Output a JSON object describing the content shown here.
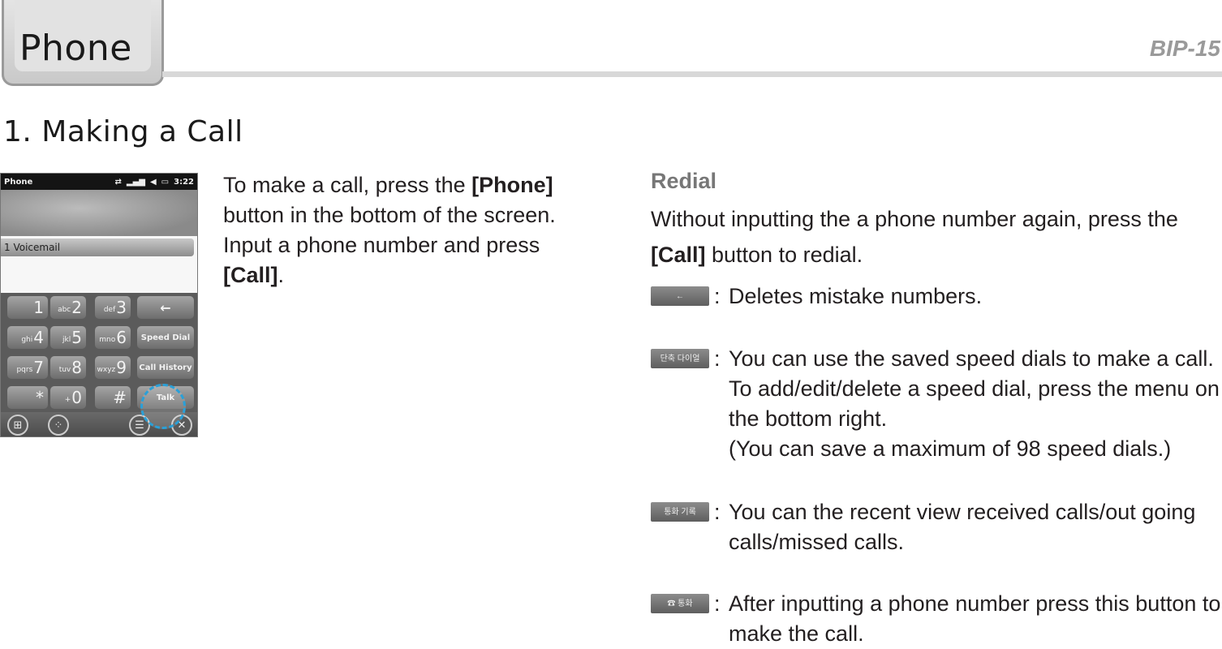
{
  "header": {
    "tab_label": "Phone",
    "page_id": "BIP-15"
  },
  "section_title": "1. Making a Call",
  "phone_screen": {
    "status_title": "Phone",
    "status_icons": [
      "sync-icon",
      "signal-icon",
      "speaker-icon",
      "battery-icon"
    ],
    "time": "3:22",
    "voicemail_entry": "1   Voicemail",
    "keys": [
      {
        "digit": "1",
        "letters": ""
      },
      {
        "digit": "2",
        "letters": "abc"
      },
      {
        "digit": "3",
        "letters": "def"
      },
      {
        "digit": "4",
        "letters": "ghi"
      },
      {
        "digit": "5",
        "letters": "jkl"
      },
      {
        "digit": "6",
        "letters": "mno"
      },
      {
        "digit": "7",
        "letters": "pqrs"
      },
      {
        "digit": "8",
        "letters": "tuv"
      },
      {
        "digit": "9",
        "letters": "wxyz"
      },
      {
        "digit": "*",
        "letters": ""
      },
      {
        "digit": "0",
        "letters": "+"
      },
      {
        "digit": "#",
        "letters": ""
      }
    ],
    "fn_keys": {
      "backspace": "←",
      "speed_dial": "Speed Dial",
      "call_history": "Call History",
      "talk": "Talk"
    },
    "highlight_color": "#2aa0d8"
  },
  "intro": {
    "part1": "To make a call, press the ",
    "phone_btn": "[Phone]",
    "part2": " button in the bottom of the screen. Input a phone number and press ",
    "call_btn": "[Call]",
    "part3": "."
  },
  "redial": {
    "heading": "Redial",
    "part1": "Without inputting the a phone number again, press the ",
    "call_btn": "[Call]",
    "part2": " button to redial."
  },
  "items": [
    {
      "button_label": "←",
      "description": "Deletes mistake numbers."
    },
    {
      "button_label": "단축 다이얼",
      "description": "You can use the saved speed dials to make a call. To add/edit/delete a speed dial, press the menu on the bottom right.",
      "note": "(You can save a maximum of 98 speed dials.)"
    },
    {
      "button_label": "통화 기록",
      "description": "You can the recent view received calls/out going calls/missed calls."
    },
    {
      "button_label": "☎ 통화",
      "description": "After inputting a phone number press this button to make the call."
    }
  ]
}
